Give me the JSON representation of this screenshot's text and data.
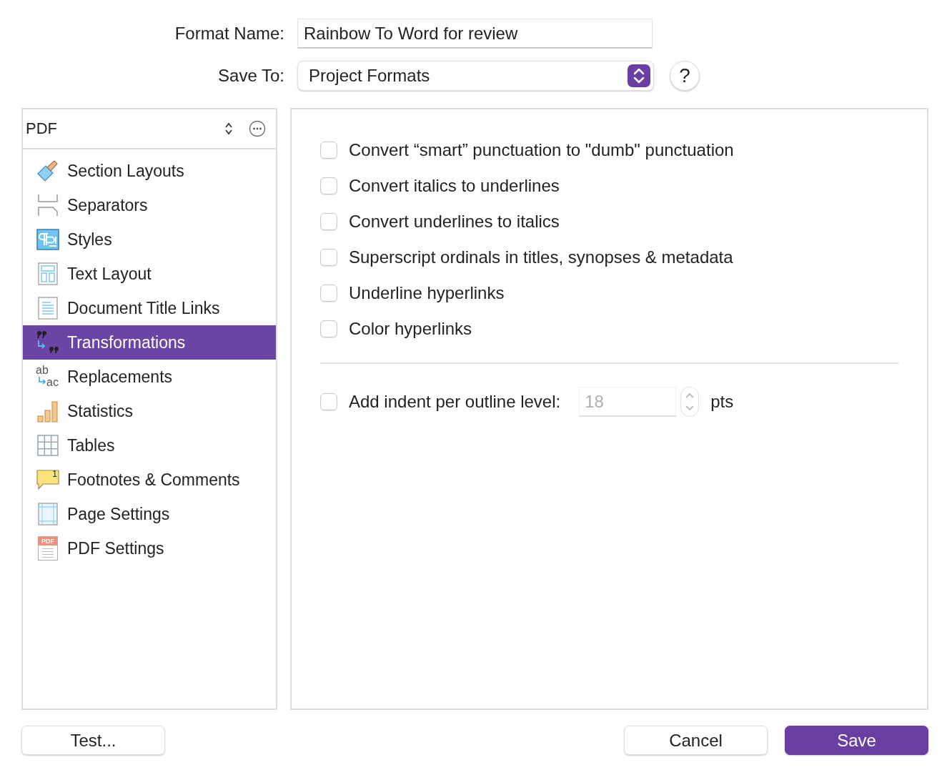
{
  "format_name": {
    "label": "Format Name:",
    "value": "Rainbow To Word for review"
  },
  "save_to": {
    "label": "Save To:",
    "value": "Project Formats",
    "help": "?"
  },
  "sidebar": {
    "format": "PDF",
    "items": [
      {
        "label": "Section Layouts",
        "kind": "brush",
        "selected": false
      },
      {
        "label": "Separators",
        "kind": "separators",
        "selected": false
      },
      {
        "label": "Styles",
        "kind": "styles",
        "selected": false
      },
      {
        "label": "Text Layout",
        "kind": "layout",
        "selected": false
      },
      {
        "label": "Document Title Links",
        "kind": "document",
        "selected": false
      },
      {
        "label": "Transformations",
        "kind": "quotes",
        "selected": true
      },
      {
        "label": "Replacements",
        "kind": "replace",
        "selected": false,
        "icon_labels": [
          "ab",
          "ac"
        ]
      },
      {
        "label": "Statistics",
        "kind": "bars",
        "selected": false
      },
      {
        "label": "Tables",
        "kind": "grid",
        "selected": false
      },
      {
        "label": "Footnotes & Comments",
        "kind": "bubble",
        "selected": false,
        "icon_labels": [
          "1"
        ]
      },
      {
        "label": "Page Settings",
        "kind": "page",
        "selected": false
      },
      {
        "label": "PDF Settings",
        "kind": "pdf",
        "selected": false,
        "icon_labels": [
          "PDF"
        ]
      }
    ]
  },
  "options": [
    {
      "label": "Convert “smart” punctuation to \"dumb\" punctuation",
      "checked": false
    },
    {
      "label": "Convert italics to underlines",
      "checked": false
    },
    {
      "label": "Convert underlines to italics",
      "checked": false
    },
    {
      "label": "Superscript ordinals in titles, synopses & metadata",
      "checked": false
    },
    {
      "label": "Underline hyperlinks",
      "checked": false
    },
    {
      "label": "Color hyperlinks",
      "checked": false
    }
  ],
  "indent": {
    "label": "Add indent per outline level:",
    "checked": false,
    "value": "18",
    "disabled": true,
    "unit": "pts"
  },
  "buttons": {
    "test": "Test...",
    "cancel": "Cancel",
    "save": "Save"
  }
}
